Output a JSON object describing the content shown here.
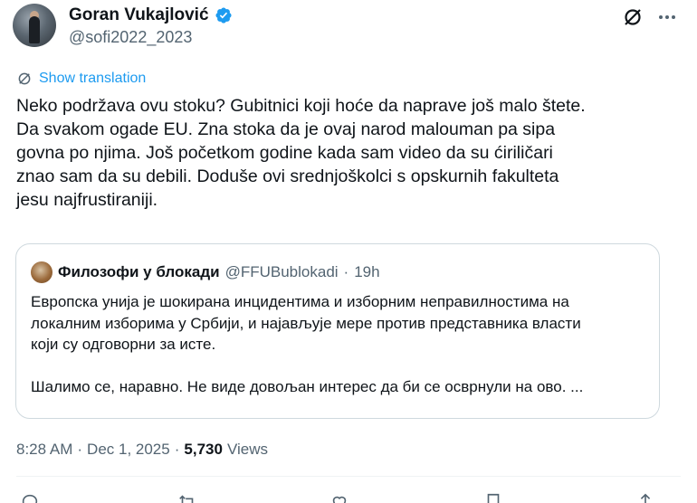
{
  "author": {
    "display_name": "Goran Vukajlović",
    "handle": "@sofi2022_2023"
  },
  "show_translation": "Show translation",
  "tweet_lines": [
    "Neko podržava ovu stoku? Gubitnici koji hoće da naprave još malo štete.",
    "Da svakom ogade EU. Zna stoka da je ovaj narod malouman pa sipa",
    "govna po njima. Još početkom godine kada sam video da su ćiriličari",
    "znao sam da su debili. Doduše ovi srednjoškolci s opskurnih fakulteta",
    "jesu najfrustiraniji."
  ],
  "quote": {
    "display_name": "Филозофи у блокади",
    "handle": "@FFUBublokadi",
    "separator": "·",
    "time": "19h",
    "lines": [
      "Европска унија је шокирана инцидентима и изборним неправилностима на",
      "локалним изборима у Србији, и најављује мере против представника власти",
      "који су одговорни за исте.",
      "Шалимо се, наравно. Не виде довољан интерес да би се осврнули на ово. ..."
    ]
  },
  "meta": {
    "time": "8:28 AM",
    "separator": "·",
    "date": "Dec 1, 2025",
    "separator2": "·",
    "views_count": "5,730",
    "views_label": "Views"
  },
  "colors": {
    "accent": "#1d9bf0",
    "secondary_text": "#536471",
    "border": "#cfd9de"
  },
  "icons": [
    "verified-icon",
    "grok-icon",
    "more-icon",
    "translate-icon",
    "reply-icon",
    "repost-icon",
    "like-icon",
    "bookmark-icon",
    "share-icon"
  ]
}
